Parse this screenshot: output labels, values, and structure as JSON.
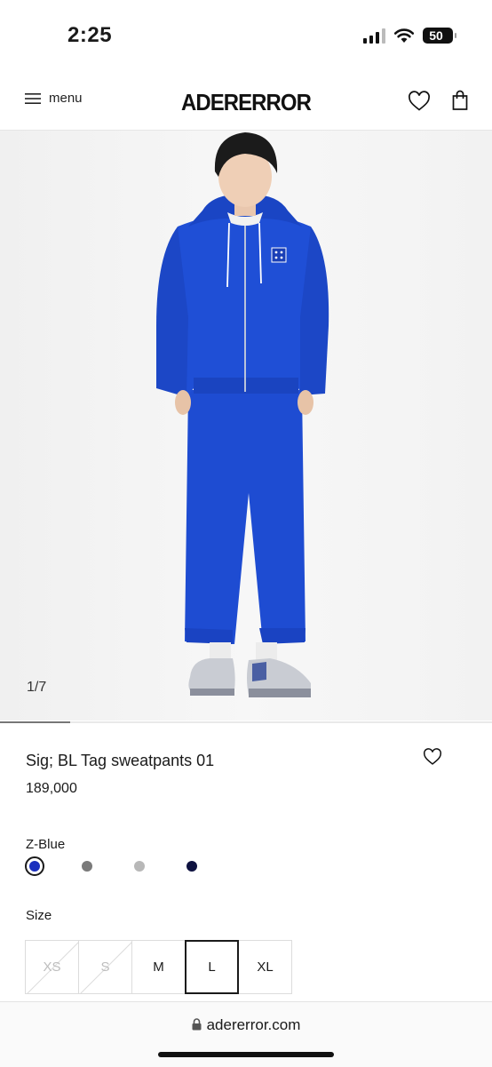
{
  "status": {
    "time": "2:25",
    "battery": "50"
  },
  "header": {
    "menu_label": "menu",
    "brand": "ADERERROR"
  },
  "gallery": {
    "counter": "1/7",
    "progress": 0.143
  },
  "product": {
    "title": "Sig; BL Tag sweatpants 01",
    "price": "189,000",
    "color_label": "Z-Blue",
    "swatches": [
      {
        "name": "Z-Blue",
        "color": "#1a2fbe",
        "selected": true
      },
      {
        "name": "gray",
        "color": "#7a7a7a",
        "selected": false
      },
      {
        "name": "light-gray",
        "color": "#b8b8b8",
        "selected": false
      },
      {
        "name": "navy",
        "color": "#0e1240",
        "selected": false
      }
    ],
    "size_label": "Size",
    "sizes": [
      {
        "label": "XS",
        "available": false,
        "selected": false
      },
      {
        "label": "S",
        "available": false,
        "selected": false
      },
      {
        "label": "M",
        "available": true,
        "selected": false
      },
      {
        "label": "L",
        "available": true,
        "selected": true
      },
      {
        "label": "XL",
        "available": true,
        "selected": false
      }
    ]
  },
  "browser": {
    "url": "adererror.com"
  },
  "colors": {
    "hoodie_blue": "#1f4fd6",
    "text": "#1a1a1a"
  }
}
